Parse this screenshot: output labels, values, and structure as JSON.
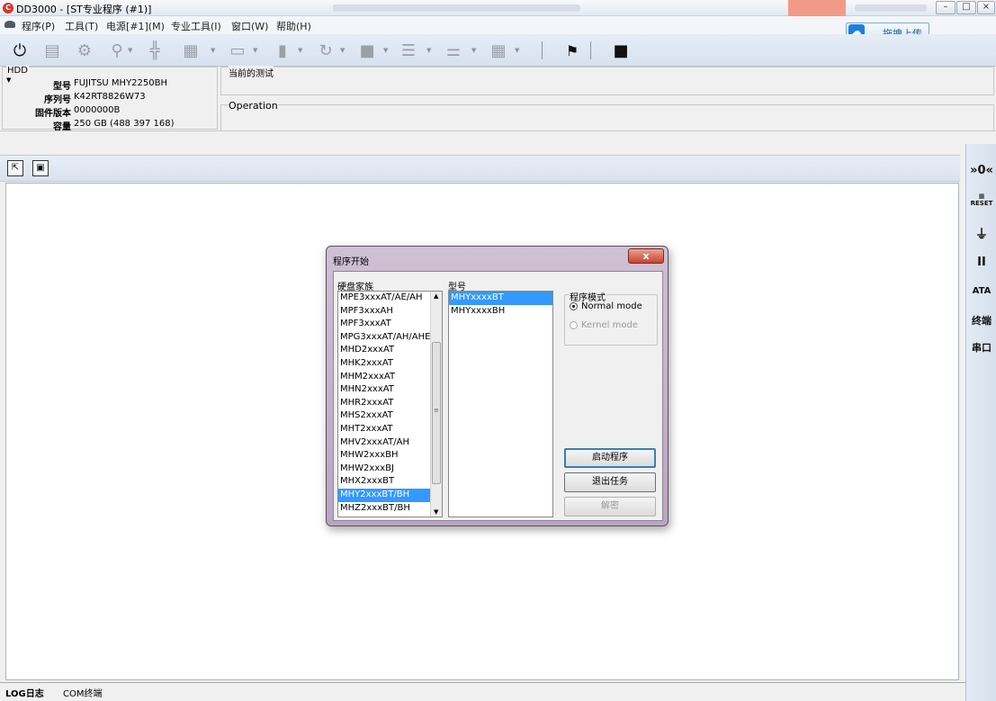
{
  "window": {
    "title": "DD3000 - [ST专业程序 (#1)]",
    "app_icon": "dd3000-logo-icon"
  },
  "menu": {
    "items": [
      "程序(P)",
      "工具(T)",
      "电源[#1](M)",
      "专业工具(I)",
      "窗口(W)",
      "帮助(H)"
    ],
    "upload_label": "拖拽上传"
  },
  "hdd": {
    "legend": "HDD",
    "rows": [
      {
        "key": "型号",
        "value": "FUJITSU MHY2250BH"
      },
      {
        "key": "序列号",
        "value": "K42RT8826W73"
      },
      {
        "key": "固件版本",
        "value": "0000000B"
      },
      {
        "key": "容量",
        "value": "250 GB (488 397 168)"
      }
    ]
  },
  "current_test": {
    "legend": "当前的测试"
  },
  "operation": {
    "legend": "Operation"
  },
  "right_bar": {
    "items": [
      "»0«",
      "RESET",
      "",
      "II",
      "ATA",
      "终端",
      "串口"
    ]
  },
  "bottom_tabs": {
    "log": "LOG日志",
    "com": "COM终端"
  },
  "dialog": {
    "title": "程序开始",
    "close_label": "x",
    "family_label": "硬盘家族",
    "model_label": "型号",
    "families": [
      "MPE3xxxAT/AE/AH",
      "MPF3xxxAH",
      "MPF3xxxAT",
      "MPG3xxxAT/AH/AHE",
      "MHD2xxxAT",
      "MHK2xxxAT",
      "MHM2xxxAT",
      "MHN2xxxAT",
      "MHR2xxxAT",
      "MHS2xxxAT",
      "MHT2xxxAT",
      "MHV2xxxAT/AH",
      "MHW2xxxBH",
      "MHW2xxxBJ",
      "MHX2xxxBT",
      "MHY2xxxBT/BH",
      "MHZ2xxxBT/BH"
    ],
    "selected_family": "MHY2xxxBT/BH",
    "models": [
      "MHYxxxxBT",
      "MHYxxxxBH"
    ],
    "selected_model": "MHYxxxxBT",
    "mode_legend": "程序模式",
    "modes": [
      {
        "label": "Normal mode",
        "checked": true,
        "enabled": true
      },
      {
        "label": "Kernel  mode",
        "checked": false,
        "enabled": false
      }
    ],
    "buttons": {
      "start": "启动程序",
      "exit": "退出任务",
      "decrypt": "解密"
    }
  }
}
